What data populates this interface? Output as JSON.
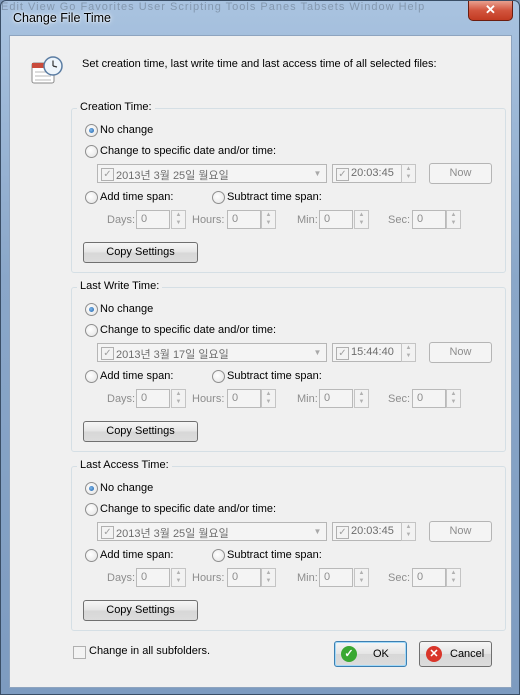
{
  "window": {
    "title": "Change File Time",
    "close_glyph": "✕"
  },
  "background_menu": "Edit  View  Go  Favorites  User  Scripting  Tools  Panes  Tabsets  Window  Help",
  "header": {
    "text": "Set creation time, last write time and last access time of all selected files:",
    "icon": "clock-calendar-icon"
  },
  "groups": [
    {
      "label": "Creation Time:",
      "no_change": "No change",
      "specific": "Change to specific date and/or time:",
      "date": "2013년   3월 25일 월요일",
      "time": "20:03:45",
      "now": "Now",
      "add_span": "Add time span:",
      "subtract_span": "Subtract time span:",
      "days_label": "Days:",
      "days": "0",
      "hours_label": "Hours:",
      "hours": "0",
      "min_label": "Min:",
      "min": "0",
      "sec_label": "Sec:",
      "sec": "0",
      "copy": "Copy Settings"
    },
    {
      "label": "Last Write Time:",
      "no_change": "No change",
      "specific": "Change to specific date and/or time:",
      "date": "2013년   3월 17일 일요일",
      "time": "15:44:40",
      "now": "Now",
      "add_span": "Add time span:",
      "subtract_span": "Subtract time span:",
      "days_label": "Days:",
      "days": "0",
      "hours_label": "Hours:",
      "hours": "0",
      "min_label": "Min:",
      "min": "0",
      "sec_label": "Sec:",
      "sec": "0",
      "copy": "Copy Settings"
    },
    {
      "label": "Last Access Time:",
      "no_change": "No change",
      "specific": "Change to specific date and/or time:",
      "date": "2013년   3월 25일 월요일",
      "time": "20:03:45",
      "now": "Now",
      "add_span": "Add time span:",
      "subtract_span": "Subtract time span:",
      "days_label": "Days:",
      "days": "0",
      "hours_label": "Hours:",
      "hours": "0",
      "min_label": "Min:",
      "min": "0",
      "sec_label": "Sec:",
      "sec": "0",
      "copy": "Copy Settings"
    }
  ],
  "subfolders": "Change in all subfolders.",
  "ok": "OK",
  "cancel": "Cancel",
  "colors": {
    "ok_icon": "#3aa832",
    "cancel_icon": "#d9352a",
    "accent": "#3c7fb1"
  }
}
